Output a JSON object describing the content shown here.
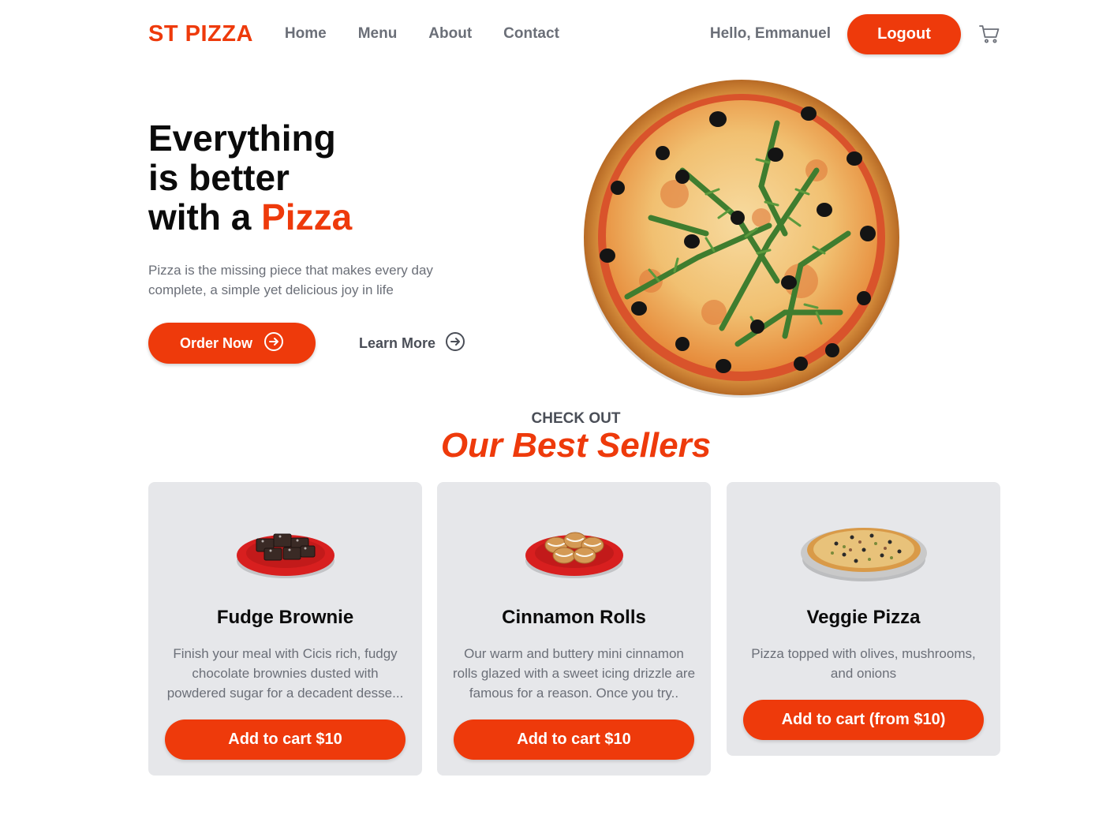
{
  "colors": {
    "accent": "#ee3a0b",
    "muted_text": "#6b6f78",
    "card_bg": "#e6e7ea"
  },
  "nav": {
    "logo": "ST PIZZA",
    "links": [
      "Home",
      "Menu",
      "About",
      "Contact"
    ],
    "greeting": "Hello, Emmanuel",
    "logout_label": "Logout",
    "cart_icon": "cart-icon"
  },
  "hero": {
    "title_line1": "Everything",
    "title_line2": "is better",
    "title_line3_prefix": "with a",
    "title_line3_accent": "Pizza",
    "subtitle": "Pizza is the missing piece that makes every day complete, a simple yet delicious joy in life",
    "order_label": "Order Now",
    "learn_label": "Learn More",
    "arrow_icon": "arrow-circle-right-icon"
  },
  "best_sellers": {
    "kicker": "CHECK OUT",
    "title": "Our Best Sellers",
    "items": [
      {
        "name": "Fudge Brownie",
        "description": "Finish your meal with Cicis rich, fudgy chocolate brownies dusted with powdered sugar for a decadent desse...",
        "button": "Add to cart $10"
      },
      {
        "name": "Cinnamon Rolls",
        "description": "Our warm and buttery mini cinnamon rolls glazed with a sweet icing drizzle are famous for a reason. Once you try..",
        "button": "Add to cart $10"
      },
      {
        "name": "Veggie Pizza",
        "description": "Pizza topped with olives, mushrooms, and onions",
        "button": "Add to cart (from $10)"
      }
    ]
  }
}
